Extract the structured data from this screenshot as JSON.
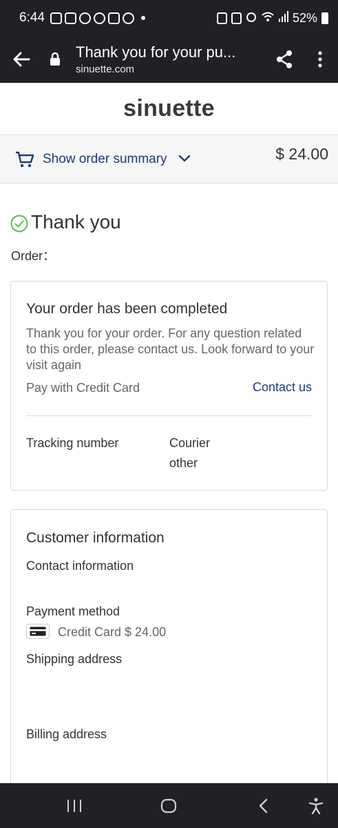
{
  "status_bar": {
    "time": "6:44",
    "battery": "52%"
  },
  "browser": {
    "page_title": "Thank you for your pu...",
    "url": "sinuette.com"
  },
  "store": {
    "name": "sinuette"
  },
  "order_summary": {
    "label": "Show order summary",
    "total": "$ 24.00"
  },
  "thank_you": {
    "title": "Thank you!",
    "order_label": "Order："
  },
  "completion_card": {
    "heading": "Your order has been completed",
    "message": "Thank you for your order. For any question related to this order, please contact us. Look forward to your visit again",
    "payment": "Pay with Credit Card",
    "contact_link": "Contact us",
    "tracking_label": "Tracking number",
    "courier_label": "Courier",
    "courier_value": "other"
  },
  "customer_card": {
    "heading": "Customer information",
    "contact_label": "Contact information",
    "payment_label": "Payment method",
    "payment_value": "Credit Card $ 24.00",
    "shipping_label": "Shipping address",
    "billing_label": "Billing address"
  }
}
